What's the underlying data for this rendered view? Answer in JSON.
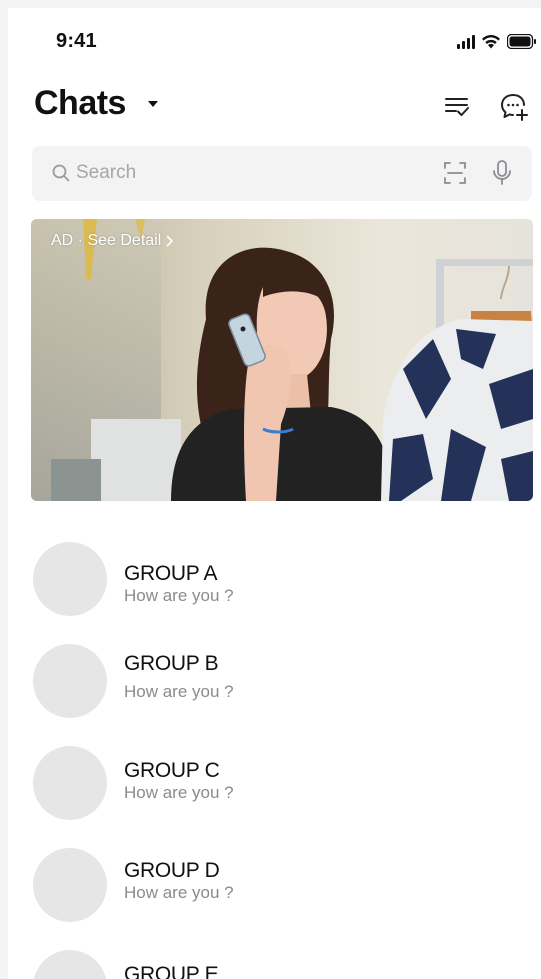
{
  "status_bar": {
    "time": "9:41",
    "icons": [
      "cellular-signal-icon",
      "wifi-icon",
      "battery-icon"
    ]
  },
  "header": {
    "title": "Chats",
    "icons": [
      "dropdown-caret-icon",
      "edit-list-icon",
      "new-chat-icon"
    ]
  },
  "search": {
    "placeholder": "Search",
    "value": "",
    "icons": [
      "search-icon",
      "scan-icon",
      "microphone-icon"
    ]
  },
  "ad_banner": {
    "label": "AD · See Detail",
    "icon": "chevron-right-icon"
  },
  "chats": [
    {
      "name": "GROUP A",
      "message": "How are you ?"
    },
    {
      "name": "GROUP B",
      "message": "How are you ?"
    },
    {
      "name": "GROUP C",
      "message": "How are you ?"
    },
    {
      "name": "GROUP D",
      "message": "How are you ?"
    },
    {
      "name": "GROUP E",
      "message": ""
    }
  ],
  "colors": {
    "text_primary": "#111111",
    "text_secondary": "#8b8b8f",
    "search_bg": "#f3f3f4",
    "avatar_placeholder": "#e6e6e6",
    "page_bg": "#ffffff"
  }
}
